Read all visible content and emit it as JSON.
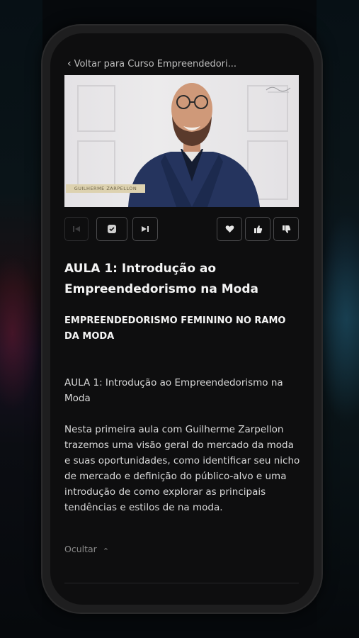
{
  "header": {
    "back_chevron": "‹",
    "back_label": "Voltar para Curso Empreendedori..."
  },
  "video": {
    "lower_third": "GUILHERME ZARPELLON",
    "icons": [
      "person-thumbnail"
    ]
  },
  "player_controls": {
    "icons": [
      "skip-previous-icon",
      "check-icon",
      "skip-next-icon",
      "heart-icon",
      "thumbs-up-icon",
      "thumbs-down-icon"
    ]
  },
  "lesson": {
    "title": "AULA 1: Introdução ao Empreendedorismo na Moda",
    "module": "EMPREENDEDORISMO FEMININO NO RAMO DA MODA",
    "subtitle": "AULA 1: Introdução ao Empreendedorismo na Moda",
    "description": "Nesta primeira aula com Guilherme Zarpellon trazemos uma visão geral do mercado da moda e suas oportunidades, como identificar seu nicho de mercado e definição do público-alvo e uma introdução de como explorar as principais tendências e estilos de na moda.",
    "hide_label": "Ocultar",
    "hide_chevron": "⌃"
  },
  "colors": {
    "background": "#0e0e0f",
    "text": "#f4f4f4",
    "muted": "#8a8a8a",
    "button_border": "#4a4a4c"
  }
}
